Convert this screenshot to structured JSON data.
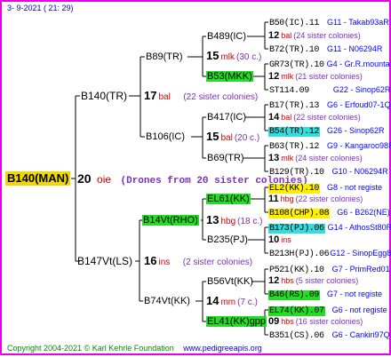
{
  "header": "3-  9-2021 ( 21: 29)",
  "footer": {
    "copyright": "Copyright 2004-2021 © Karl Kehrle Foundation",
    "site": "www.pedigreeapis.org"
  },
  "root": {
    "id": "B140(MAN)",
    "num": "20",
    "col": "oie",
    "drones": "(Drones from 20 sister colonies)"
  },
  "gen1": [
    {
      "id": "B140(TR)",
      "num": "17",
      "col": "bal",
      "sis": "(22 sister colonies)"
    },
    {
      "id": "B147Vt(LS)",
      "num": "16",
      "col": "ins",
      "sis": "(2 sister colonies)"
    }
  ],
  "gen2": [
    {
      "id": "B89(TR)",
      "num": "",
      "col": "",
      "sis": ""
    },
    {
      "id": "B106(IC)",
      "num": "15",
      "col": "bal",
      "sis": "(20 c.)"
    },
    {
      "id": "B14Vt(RHO)",
      "num": "13",
      "col": "hbg",
      "sis": "(18 c.)"
    },
    {
      "id": "B74Vt(KK)",
      "num": "14",
      "col": "mm",
      "sis": "(7 c.)"
    }
  ],
  "gen3": [
    {
      "id": "B489(IC)",
      "num": "15",
      "col": "mlk",
      "sis": "(30 c.)"
    },
    {
      "id": "B53(MKK)",
      "num": "",
      "col": "",
      "sis": ""
    },
    {
      "id": "B417(IC)",
      "num": "",
      "col": "",
      "sis": ""
    },
    {
      "id": "B69(TR)",
      "num": "",
      "col": "",
      "sis": ""
    },
    {
      "id": "EL61(KK)",
      "num": "",
      "col": "",
      "sis": ""
    },
    {
      "id": "B235(PJ)",
      "num": "",
      "col": "",
      "sis": ""
    },
    {
      "id": "B56Vt(KK)",
      "num": "",
      "col": "",
      "sis": ""
    },
    {
      "id": "EL41(KK)gpp",
      "num": "",
      "col": "",
      "sis": ""
    }
  ],
  "gen4": [
    {
      "id": "B50(IC).11",
      "extra": "G11 - Takab93aR"
    },
    {
      "num": "12",
      "col": "bal",
      "sis": "(24 sister colonies)"
    },
    {
      "id": "B72(TR).10",
      "extra": "G11 - N06294R"
    },
    {
      "id": "GR73(TR).10",
      "extra": "G4 - Gr.R.mounta"
    },
    {
      "num": "12",
      "col": "mlk",
      "sis": "(21 sister colonies)"
    },
    {
      "id": "ST114.09",
      "extra": "G22 - Sinop62R"
    },
    {
      "id": "B17(TR).13",
      "extra": "G6 - Erfoud07-1Q"
    },
    {
      "num": "14",
      "col": "bal",
      "sis": "(22 sister colonies)"
    },
    {
      "id": "B54(TR).12",
      "extra": "G26 - Sinop62R"
    },
    {
      "id": "B63(TR).12",
      "extra": "G9 - Kangaroo98R"
    },
    {
      "num": "13",
      "col": "mlk",
      "sis": "(24 sister colonies)"
    },
    {
      "id": "B129(TR).10",
      "extra": "G10 - N06294R"
    },
    {
      "id": "EL2(KK).10",
      "extra": "G8 - not registe"
    },
    {
      "num": "11",
      "col": "hbg",
      "sis": "(22 sister colonies)"
    },
    {
      "id": "B108(CHP).08",
      "extra": "G6 - B262(NE)"
    },
    {
      "id": "B173(PJ).06",
      "extra": "G14 - AthosSt80R"
    },
    {
      "num": "10",
      "col": "ins",
      "sis": ""
    },
    {
      "id": "B213H(PJ).06",
      "extra": "G12 - SinopEgg86R"
    },
    {
      "id": "P521(KK).10",
      "extra": "G7 - PrimRed01"
    },
    {
      "num": "12",
      "col": "hbs",
      "sis": "(5 sister colonies)"
    },
    {
      "id": "B46(RS).09",
      "extra": "G7 - not registe"
    },
    {
      "id": "EL74(KK).07",
      "extra": "G6 - not registe"
    },
    {
      "num": "09",
      "col": "hbs",
      "sis": "(16 sister colonies)"
    },
    {
      "id": "B351(CS).06",
      "extra": "G6 - Cankiri97Q"
    }
  ],
  "colors": {
    "border": "#e800e8",
    "lines": "#000000",
    "green": "#22dd22",
    "cyan": "#33dddd",
    "yellow": "#ffee00",
    "root": "#f2d700"
  }
}
